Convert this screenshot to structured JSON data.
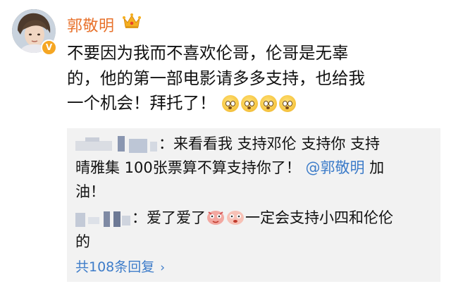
{
  "post": {
    "author": "郭敬明",
    "verified_badge": "V",
    "lines": [
      "不要因为我而不喜欢伦哥，伦哥是无辜",
      "的，他的第一部电影请多多支持，也给我",
      "一个机会！拜托了！"
    ],
    "emoji_count": 4
  },
  "replies": {
    "items": [
      {
        "lines": [
          "：来看看我 支持邓伦 支持你 支持",
          "晴雅集 100张票算不算支持你了！",
          "油！"
        ],
        "mention": "@郭敬明",
        "mention_suffix": " 加"
      },
      {
        "lines_before_sticker": "：爱了爱了",
        "after_sticker": "一定会支持小四和伦伦",
        "line2": "的"
      }
    ],
    "more_label": "共108条回复",
    "chevron": "›"
  },
  "colors": {
    "username": "#e8722c",
    "link": "#3d7cc9",
    "reply_bg": "#f2f2f2",
    "verified": "#f5a623"
  },
  "icons": [
    "crown-icon",
    "verified-icon",
    "chevron-right-icon",
    "sticker-icon"
  ]
}
